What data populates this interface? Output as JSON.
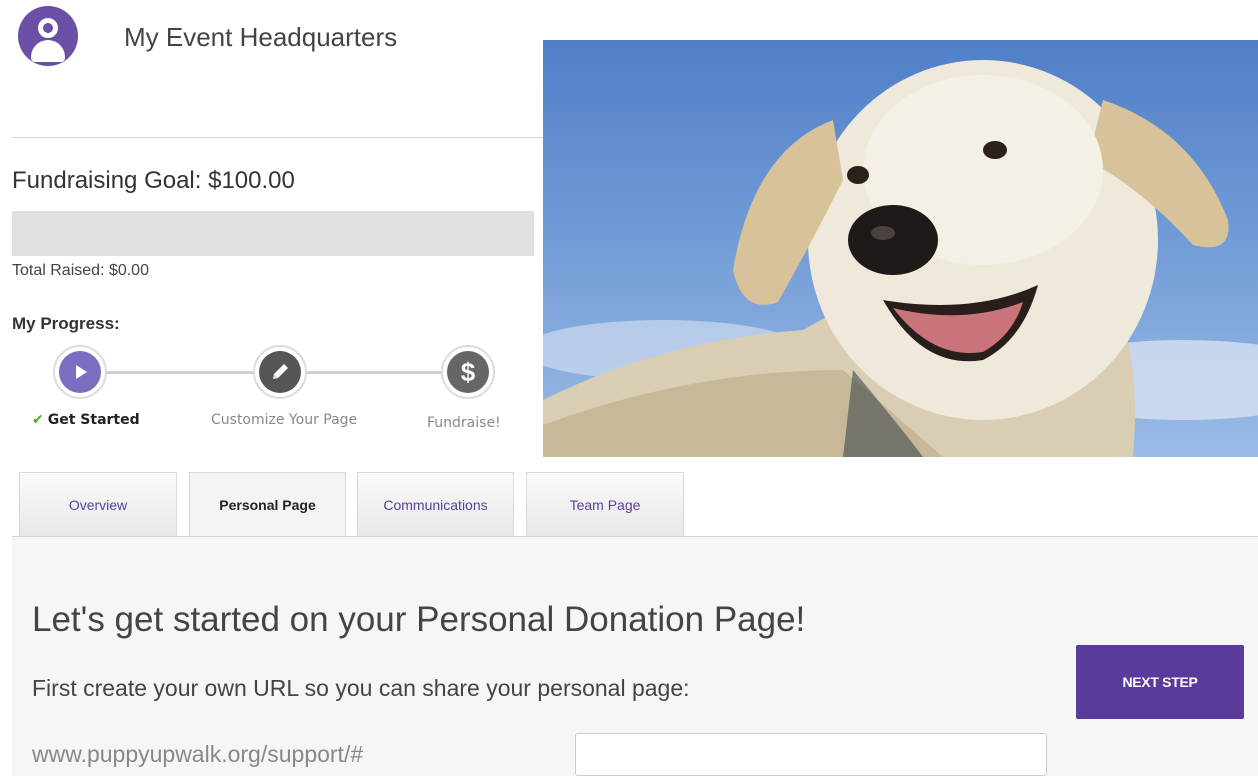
{
  "header": {
    "title": "My Event Headquarters",
    "avatar_icon": "user-avatar-icon"
  },
  "fundraising": {
    "goal_label": "Fundraising Goal: $100.00",
    "total_raised_label": "Total Raised: $0.00",
    "progress_fraction": 0
  },
  "progress": {
    "title": "My Progress:",
    "steps": [
      {
        "label": "Get Started",
        "icon": "play-icon",
        "done": true,
        "check_icon": "checkmark-icon"
      },
      {
        "label": "Customize Your Page",
        "icon": "pencil-icon",
        "done": false
      },
      {
        "label": "Fundraise!",
        "icon": "dollar-icon",
        "glyph": "$",
        "done": false
      }
    ]
  },
  "tabs": [
    {
      "label": "Overview",
      "active": false
    },
    {
      "label": "Personal Page",
      "active": true
    },
    {
      "label": "Communications",
      "active": false
    },
    {
      "label": "Team Page",
      "active": false
    }
  ],
  "main": {
    "headline": "Let's get started on your Personal Donation Page!",
    "subline": "First create your own URL so you can share your personal page:",
    "next_button_label": "NEXT STEP",
    "url_prefix": "www.puppyupwalk.org/support/#",
    "url_value": ""
  },
  "colors": {
    "brand_purple": "#5a3a9a",
    "check_green": "#4aa832"
  }
}
